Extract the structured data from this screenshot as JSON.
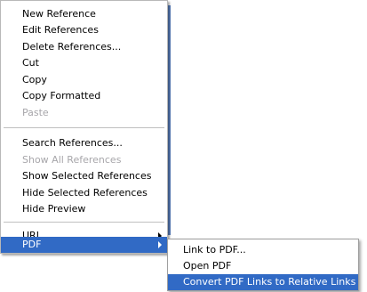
{
  "colors": {
    "selection_bg": "#316ac5",
    "disabled_text": "#a7a6aa"
  },
  "context_menu": {
    "items": [
      {
        "label": "New Reference",
        "enabled": true
      },
      {
        "label": "Edit References",
        "enabled": true
      },
      {
        "label": "Delete References...",
        "enabled": true
      },
      {
        "label": "Cut",
        "enabled": true
      },
      {
        "label": "Copy",
        "enabled": true
      },
      {
        "label": "Copy Formatted",
        "enabled": true
      },
      {
        "label": "Paste",
        "enabled": false
      },
      {
        "label": "Search References...",
        "enabled": true
      },
      {
        "label": "Show All References",
        "enabled": false
      },
      {
        "label": "Show Selected References",
        "enabled": true
      },
      {
        "label": "Hide Selected References",
        "enabled": true
      },
      {
        "label": "Hide Preview",
        "enabled": true
      },
      {
        "label": "URL",
        "enabled": true,
        "submenu": true
      },
      {
        "label": "PDF",
        "enabled": true,
        "submenu": true,
        "selected": true
      }
    ]
  },
  "pdf_submenu": {
    "items": [
      {
        "label": "Link to PDF...",
        "enabled": true
      },
      {
        "label": "Open PDF",
        "enabled": true
      },
      {
        "label": "Convert PDF Links to Relative Links",
        "enabled": true,
        "selected": true
      }
    ]
  }
}
